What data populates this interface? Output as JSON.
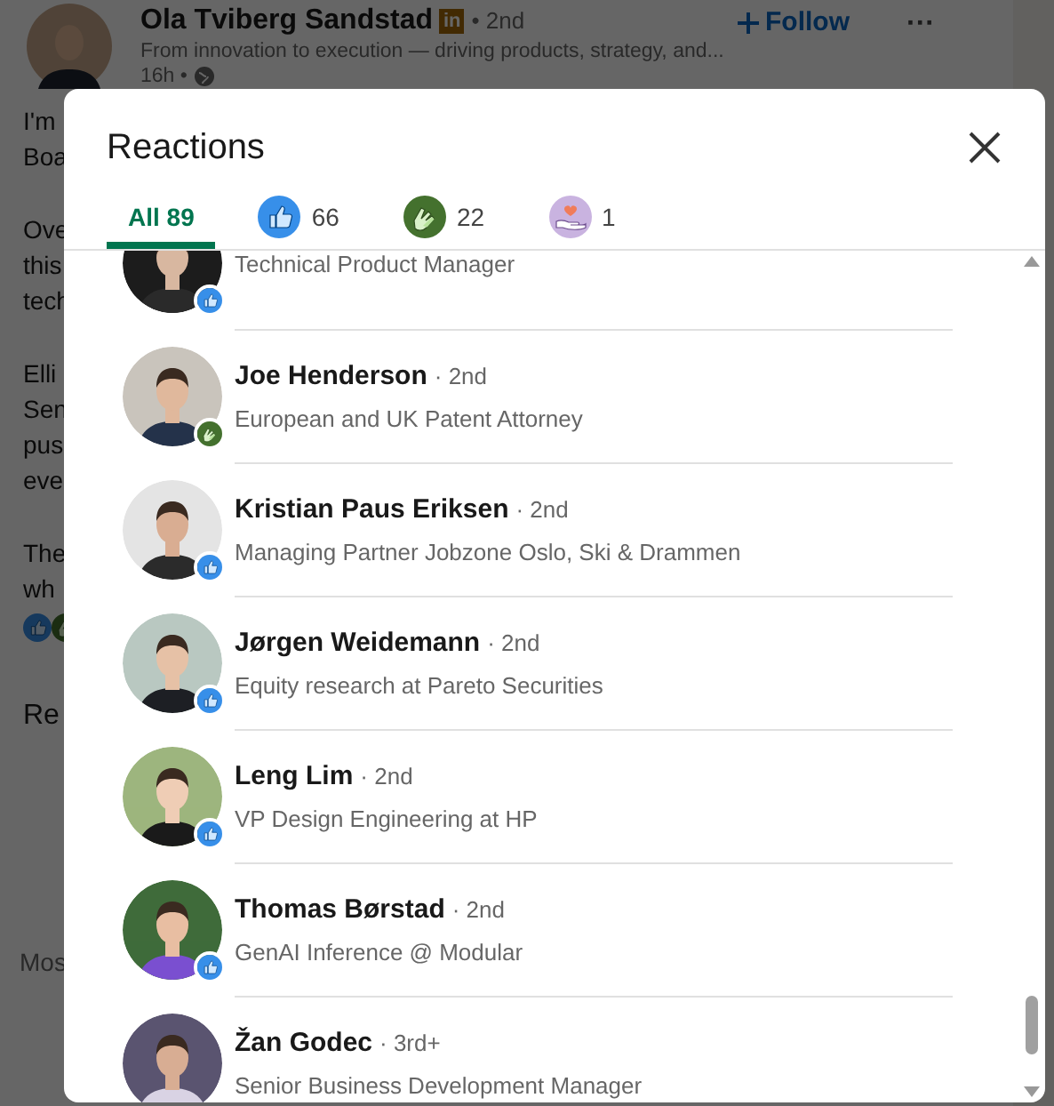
{
  "post": {
    "author": "Ola Tviberg Sandstad",
    "badge": "in",
    "degree": "• 2nd",
    "headline": "From innovation to execution — driving products, strategy, and...",
    "time": "16h •",
    "follow": "Follow",
    "more": "···",
    "text_fragments": [
      [
        "I'm",
        "Boa"
      ],
      [
        "Ove",
        "this",
        "tech"
      ],
      [
        "Elli",
        "Sen",
        "pus",
        "eve"
      ],
      [
        "The",
        "wh"
      ]
    ],
    "reactions_heading": "Re",
    "most_heading": "Mos"
  },
  "modal": {
    "title": "Reactions",
    "tabs": [
      {
        "kind": "all",
        "label": "All 89",
        "selected": true
      },
      {
        "kind": "like",
        "label": "66",
        "selected": false
      },
      {
        "kind": "celebrate",
        "label": "22",
        "selected": false
      },
      {
        "kind": "support",
        "label": "1",
        "selected": false
      }
    ],
    "people": [
      {
        "subtitle": "Technical Product Manager",
        "kind": "like"
      },
      {
        "name": "Joe Henderson",
        "degree": "· 2nd",
        "subtitle": "European and UK Patent Attorney",
        "kind": "celebrate"
      },
      {
        "name": "Kristian Paus Eriksen",
        "degree": "· 2nd",
        "subtitle": "Managing Partner Jobzone Oslo, Ski & Drammen",
        "kind": "like"
      },
      {
        "name": "Jørgen Weidemann",
        "degree": "· 2nd",
        "subtitle": "Equity research at Pareto Securities",
        "kind": "like"
      },
      {
        "name": "Leng Lim",
        "degree": "· 2nd",
        "subtitle": "VP Design Engineering at HP",
        "kind": "like"
      },
      {
        "name": "Thomas Børstad",
        "degree": "· 2nd",
        "subtitle": "GenAI Inference @ Modular",
        "kind": "like"
      },
      {
        "name": "Žan Godec",
        "degree": "· 3rd+",
        "subtitle": "Senior Business Development Manager"
      }
    ]
  }
}
